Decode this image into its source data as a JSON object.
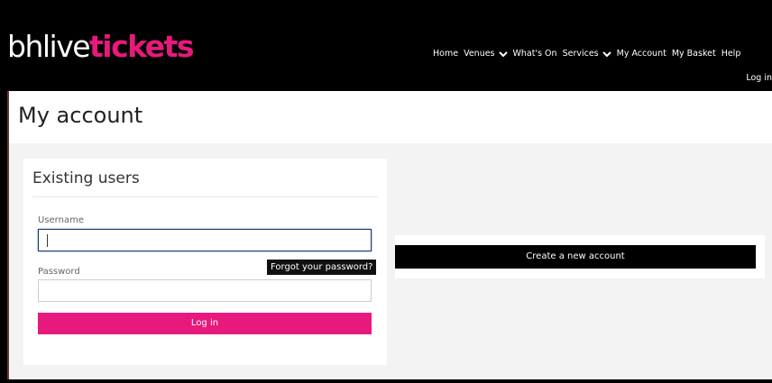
{
  "header": {
    "logo_light": "bhlive",
    "logo_bold": "tickets",
    "nav": [
      {
        "label": "Home",
        "dropdown": false
      },
      {
        "label": "Venues",
        "dropdown": true
      },
      {
        "label": "What's On",
        "dropdown": false
      },
      {
        "label": "Services",
        "dropdown": true
      },
      {
        "label": "My Account",
        "dropdown": false
      },
      {
        "label": "My Basket",
        "dropdown": false
      },
      {
        "label": "Help",
        "dropdown": false
      }
    ],
    "login_link": "Log in"
  },
  "page": {
    "title": "My account"
  },
  "existing_users": {
    "heading": "Existing users",
    "username_label": "Username",
    "username_value": "",
    "password_label": "Password",
    "password_value": "",
    "forgot_label": "Forgot your password?",
    "login_button": "Log in"
  },
  "new_account": {
    "create_button": "Create a new account"
  },
  "colors": {
    "brand_pink": "#e8197d",
    "header_bg": "#000000"
  }
}
